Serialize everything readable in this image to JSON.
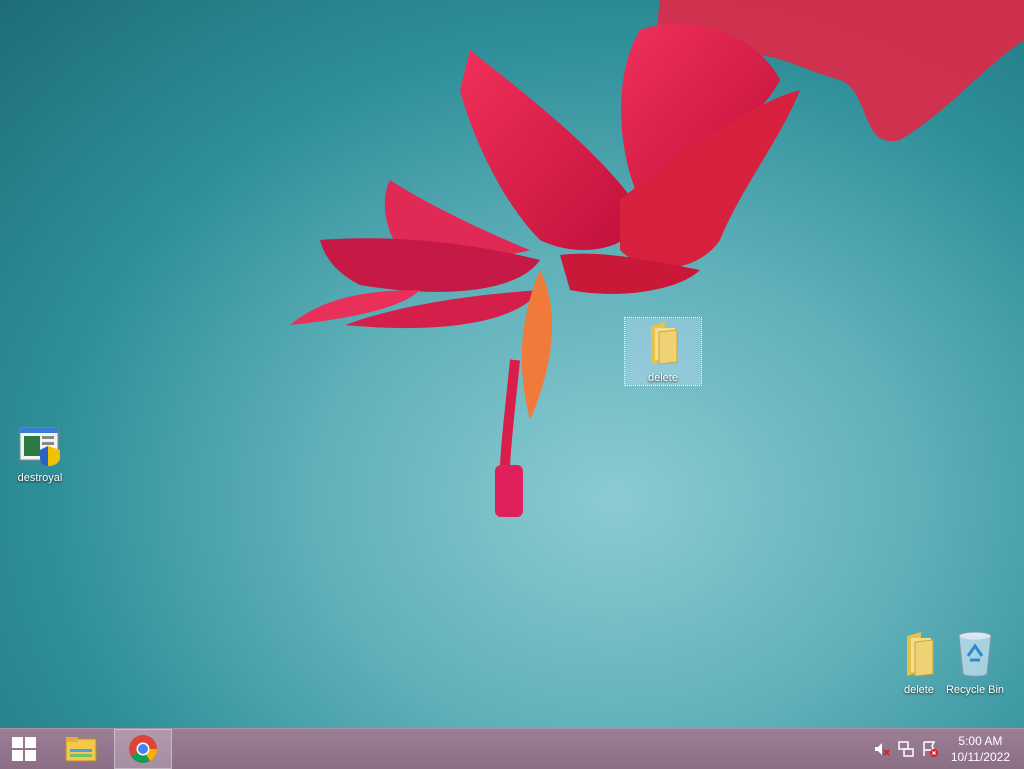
{
  "desktop": {
    "icons": [
      {
        "label": "destroyal",
        "icon": "installer-shield-icon"
      },
      {
        "label": "delete",
        "icon": "folder-icon"
      },
      {
        "label": "delete",
        "icon": "folder-icon"
      },
      {
        "label": "Recycle Bin",
        "icon": "recycle-bin-icon"
      }
    ]
  },
  "taskbar": {
    "start": "windows-logo-icon",
    "pinned": [
      "file-explorer-icon",
      "chrome-icon"
    ],
    "tray": [
      "volume-muted-icon",
      "network-icon",
      "action-center-alert-icon"
    ],
    "clock": {
      "time": "5:00 AM",
      "date": "10/11/2022"
    }
  },
  "colors": {
    "accent": "#8b6f87",
    "wallpaper": "#3a9aa4",
    "flower": "#e8204a"
  }
}
